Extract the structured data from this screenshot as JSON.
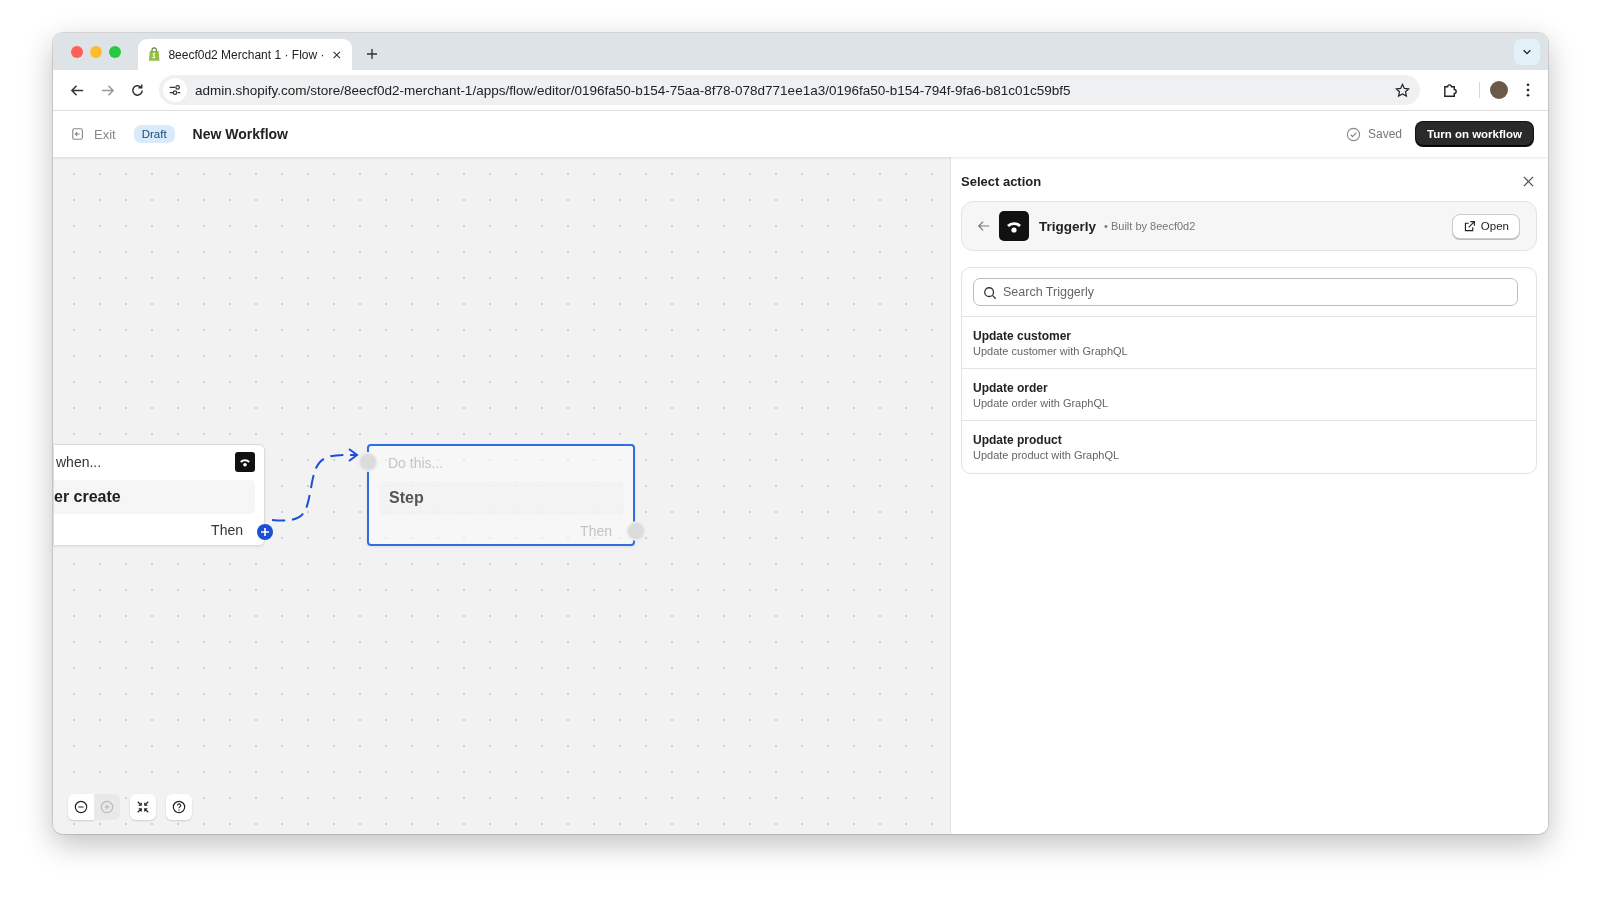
{
  "browser": {
    "tabs": [
      {
        "title": "8eecf0d2 Merchant 1 · Flow ·",
        "selected": true
      }
    ],
    "url": "admin.shopify.com/store/8eecf0d2-merchant-1/apps/flow/editor/0196fa50-b154-75aa-8f78-078d771ee1a3/0196fa50-b154-794f-9fa6-b81c01c59bf5"
  },
  "header": {
    "exit": "Exit",
    "badge": "Draft",
    "title": "New Workflow",
    "status": "Saved",
    "primary_button": "Turn on workflow"
  },
  "canvas": {
    "nodes": [
      {
        "kind": "trigger",
        "selected": false,
        "heading": "when...",
        "title": "er create",
        "footer": "Then"
      },
      {
        "kind": "action",
        "selected": true,
        "heading": "Do this...",
        "title": "Step",
        "footer": "Then"
      }
    ],
    "controls": [
      {
        "kind": "zoom-out",
        "disabled": false
      },
      {
        "kind": "zoom-in",
        "disabled": true
      },
      {
        "kind": "fit",
        "disabled": false
      },
      {
        "kind": "help",
        "disabled": false
      }
    ]
  },
  "panel": {
    "title": "Select action",
    "app": {
      "name": "Triggerly",
      "byline": "• Built by 8eecf0d2",
      "open_button": "Open"
    },
    "search": {
      "placeholder": "Search Triggerly"
    },
    "actions": [
      {
        "title": "Update customer",
        "description": "Update customer with GraphQL"
      },
      {
        "title": "Update order",
        "description": "Update order with GraphQL"
      },
      {
        "title": "Update product",
        "description": "Update product with GraphQL"
      }
    ]
  }
}
